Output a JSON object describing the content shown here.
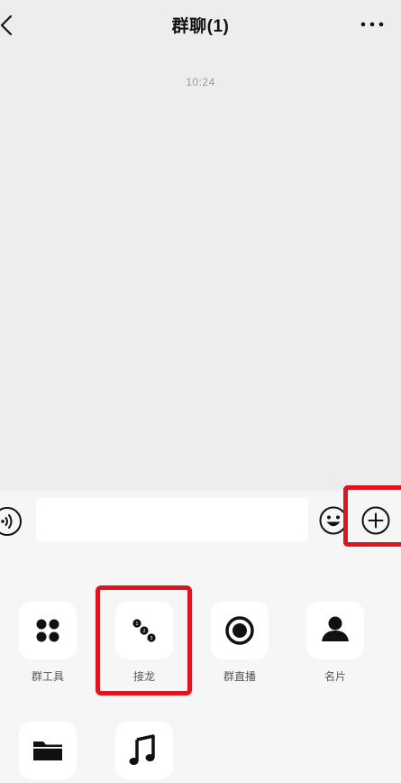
{
  "nav": {
    "title": "群聊(1)",
    "back_icon": "chevron-left-icon",
    "more_icon": "more-dots-icon"
  },
  "chat": {
    "timestamp": "10:24"
  },
  "input_bar": {
    "voice_icon": "voice-icon",
    "emoji_icon": "emoji-icon",
    "plus_icon": "plus-circle-icon"
  },
  "panel": {
    "items": [
      {
        "label": "群工具",
        "icon": "group-tools-icon"
      },
      {
        "label": "接龙",
        "icon": "solitaire-icon"
      },
      {
        "label": "群直播",
        "icon": "live-icon"
      },
      {
        "label": "名片",
        "icon": "contact-card-icon"
      },
      {
        "label": "",
        "icon": "folder-icon"
      },
      {
        "label": "",
        "icon": "music-icon"
      }
    ]
  },
  "highlight_color": "#e0141c"
}
